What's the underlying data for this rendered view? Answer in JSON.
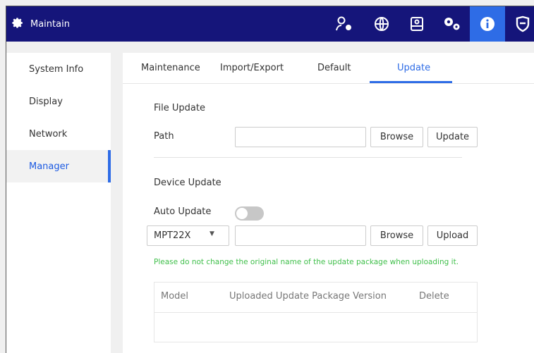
{
  "header": {
    "title": "Maintain",
    "icons": [
      "user-settings-icon",
      "network-globe-icon",
      "storage-icon",
      "system-gears-icon",
      "info-icon",
      "shield-icon"
    ],
    "active_icon": "info-icon"
  },
  "sidebar": {
    "items": [
      {
        "label": "System Info"
      },
      {
        "label": "Display"
      },
      {
        "label": "Network"
      },
      {
        "label": "Manager"
      }
    ],
    "active": "Manager"
  },
  "tabs": [
    {
      "label": "Maintenance"
    },
    {
      "label": "Import/Export"
    },
    {
      "label": "Default"
    },
    {
      "label": "Update"
    }
  ],
  "active_tab": "Update",
  "file_update": {
    "section_title": "File Update",
    "path_label": "Path",
    "path_value": "",
    "browse_label": "Browse",
    "update_label": "Update"
  },
  "device_update": {
    "section_title": "Device Update",
    "auto_update_label": "Auto Update",
    "auto_update_on": false,
    "device_model_selected": "MPT22X",
    "file_value": "",
    "browse_label": "Browse",
    "upload_label": "Upload",
    "hint": "Please do not change the original name of the update package when uploading it.",
    "table": {
      "columns": [
        "Model",
        "Uploaded Update Package Version",
        "Delete"
      ],
      "rows": []
    }
  },
  "colors": {
    "topbar": "#15157a",
    "accent": "#2e6ce6",
    "hint": "#3fbf4a"
  }
}
